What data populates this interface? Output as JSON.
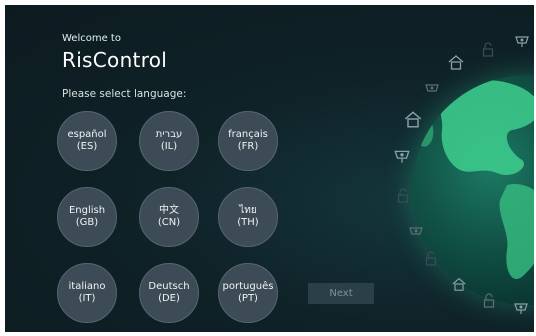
{
  "header": {
    "welcome": "Welcome to",
    "app_name": "RisControl",
    "prompt": "Please select language:"
  },
  "languages": [
    {
      "name": "español",
      "code": "(ES)"
    },
    {
      "name": "עברית",
      "code": "(IL)"
    },
    {
      "name": "français",
      "code": "(FR)"
    },
    {
      "name": "English",
      "code": "(GB)"
    },
    {
      "name": "中文",
      "code": "(CN)"
    },
    {
      "name": "ไทย",
      "code": "(TH)"
    },
    {
      "name": "italiano",
      "code": "(IT)"
    },
    {
      "name": "Deutsch",
      "code": "(DE)"
    },
    {
      "name": "português",
      "code": "(PT)"
    }
  ],
  "next_label": "Next",
  "colors": {
    "background": "#0f2228",
    "button_fill": "#3c4b55",
    "globe_land": "#3ecf8e",
    "next_button": "#2a3f48"
  },
  "decor_icons": [
    "house-icon",
    "lock-icon",
    "camera-icon",
    "globe-icon"
  ]
}
